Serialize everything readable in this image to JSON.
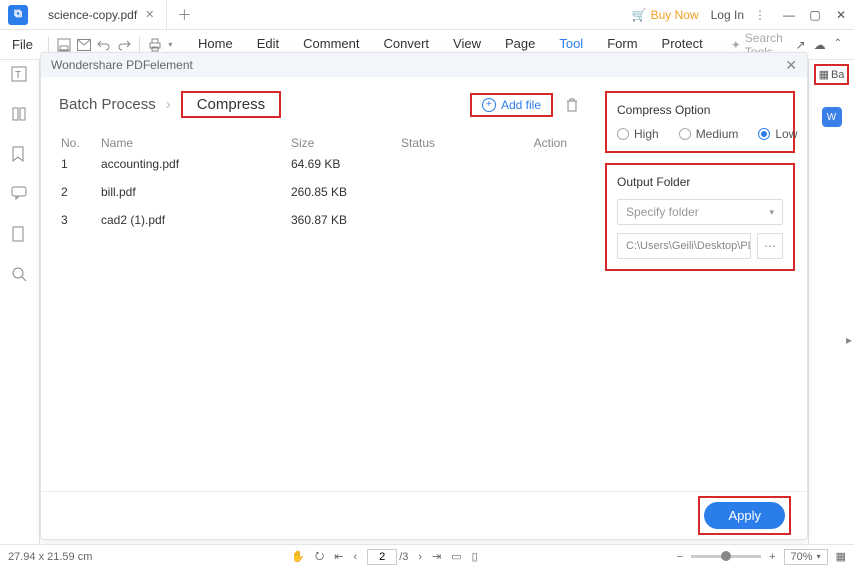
{
  "titlebar": {
    "tab_name": "science-copy.pdf",
    "buy": "Buy Now",
    "login": "Log In"
  },
  "menubar": {
    "file": "File",
    "items": [
      "Home",
      "Edit",
      "Comment",
      "Convert",
      "View",
      "Page",
      "Tool",
      "Form",
      "Protect"
    ],
    "active_index": 6,
    "search_placeholder": "Search Tools"
  },
  "rightrail": {
    "batch_label": "Ba"
  },
  "modal": {
    "title": "Wondershare PDFelement",
    "breadcrumb_root": "Batch Process",
    "breadcrumb_current": "Compress",
    "add_file": "Add file",
    "columns": {
      "no": "No.",
      "name": "Name",
      "size": "Size",
      "status": "Status",
      "action": "Action"
    },
    "rows": [
      {
        "no": "1",
        "name": "accounting.pdf",
        "size": "64.69 KB"
      },
      {
        "no": "2",
        "name": "bill.pdf",
        "size": "260.85 KB"
      },
      {
        "no": "3",
        "name": "cad2 (1).pdf",
        "size": "360.87 KB"
      }
    ],
    "compress": {
      "title": "Compress Option",
      "options": [
        "High",
        "Medium",
        "Low"
      ],
      "selected_index": 2
    },
    "output": {
      "title": "Output Folder",
      "placeholder": "Specify folder",
      "path": "C:\\Users\\Geili\\Desktop\\PDFelement\\Op"
    },
    "apply": "Apply"
  },
  "status": {
    "dimensions": "27.94 x 21.59 cm",
    "page_current": "2",
    "page_total": "/3",
    "zoom": "70%"
  }
}
